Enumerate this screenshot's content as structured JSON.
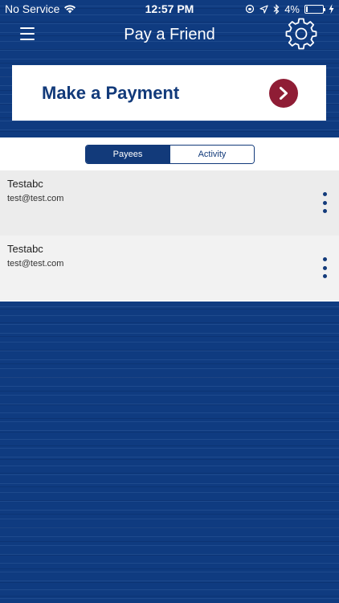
{
  "status_bar": {
    "carrier": "No Service",
    "time": "12:57 PM",
    "battery": "4%"
  },
  "header": {
    "title": "Pay a Friend",
    "menu_icon": "hamburger-menu-icon",
    "settings_icon": "gear-icon"
  },
  "banner": {
    "label": "Make a Payment",
    "icon": "chevron-right-icon"
  },
  "tabs": [
    {
      "label": "Payees",
      "active": true
    },
    {
      "label": "Activity",
      "active": false
    }
  ],
  "payees": [
    {
      "name": "Testabc",
      "email": "test@test.com"
    },
    {
      "name": "Testabc",
      "email": "test@test.com"
    }
  ],
  "colors": {
    "primary": "#123a7a",
    "background": "#0f3b80",
    "accent": "#8f1d35"
  }
}
